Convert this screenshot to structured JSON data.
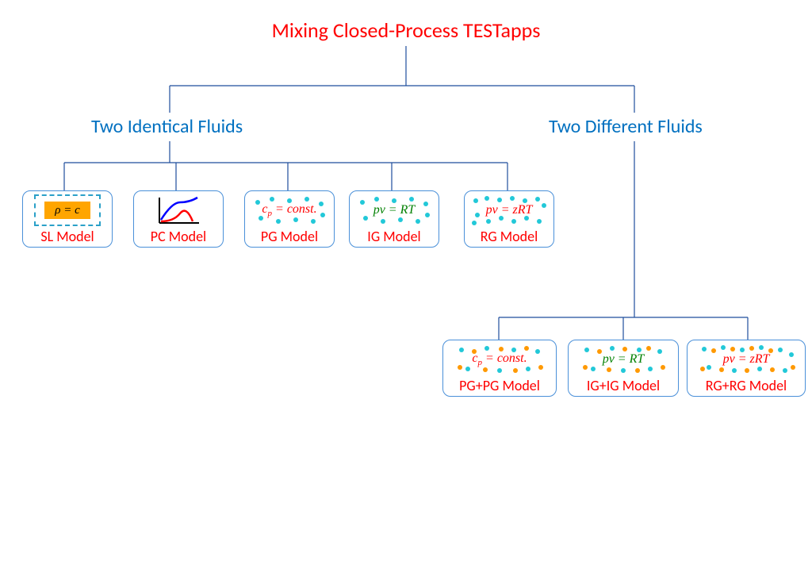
{
  "title": "Mixing Closed-Process TESTapps",
  "branch_left": "Two Identical Fluids",
  "branch_right": "Two Different Fluids",
  "nodes": {
    "sl": {
      "label": "SL Model",
      "formula_html": "ρ = c"
    },
    "pc": {
      "label": "PC Model"
    },
    "pg": {
      "label": "PG Model",
      "formula_html": "<span class='red'>c<sub>p</sub> = const.</span>"
    },
    "ig": {
      "label": "IG Model",
      "formula_html": "<span class='green'>pv = RT</span>"
    },
    "rg": {
      "label": "RG Model",
      "formula_html": "<span class='red'>pv = zRT</span>"
    },
    "pgpg": {
      "label": "PG+PG Model",
      "formula_html": "<span class='red'>c<sub>p</sub> = const.</span>"
    },
    "igig": {
      "label": "IG+IG Model",
      "formula_html": "<span class='green'>pv = RT</span>"
    },
    "rgrg": {
      "label": "RG+RG Model",
      "formula_html": "<span class='red'>pv = zRT</span>"
    }
  }
}
